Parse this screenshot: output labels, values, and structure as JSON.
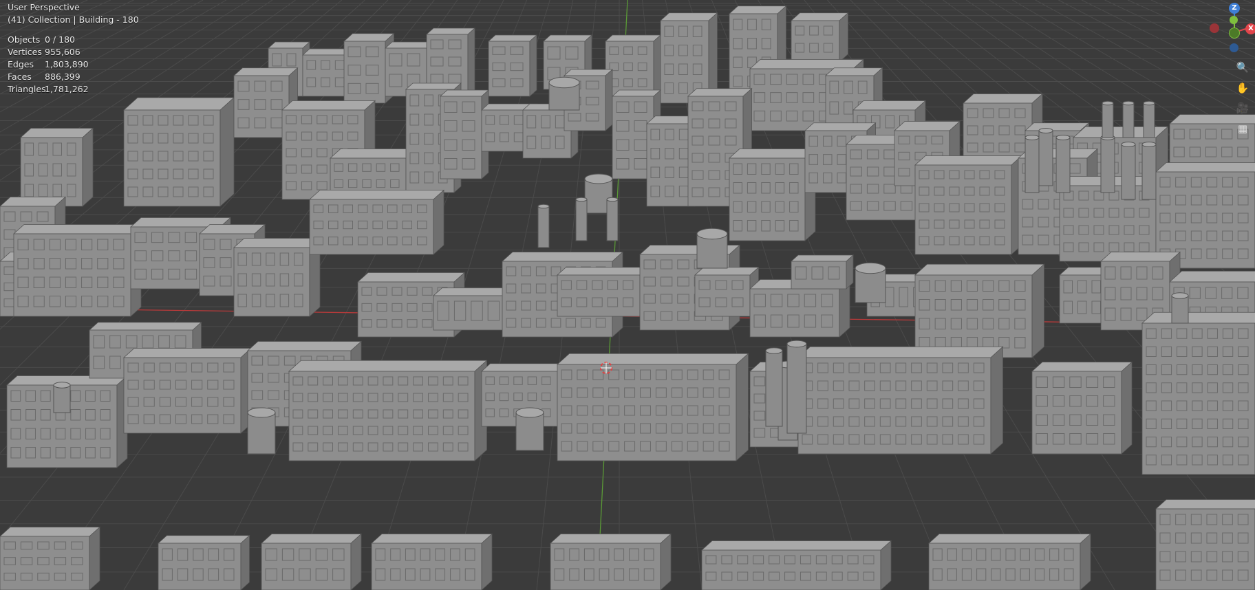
{
  "viewport": {
    "view_name": "User Perspective",
    "collection_info": "(41) Collection | Building - 180",
    "stats": [
      {
        "label": "Objects",
        "value": "0 / 180"
      },
      {
        "label": "Vertices",
        "value": "955,606"
      },
      {
        "label": "Edges",
        "value": "1,803,890"
      },
      {
        "label": "Faces",
        "value": "886,399"
      },
      {
        "label": "Triangles",
        "value": "1,781,262"
      }
    ]
  },
  "gizmo": {
    "z_label": "Z",
    "x_label": "X",
    "colors": {
      "x": "#e2454b",
      "y": "#7fbf3e",
      "z": "#3f7fd6",
      "neg_x": "#9a3438",
      "neg_y": "#4c7a28",
      "neg_z": "#2e5a93"
    }
  },
  "nav_icons": [
    "zoom-icon",
    "hand-pan-icon",
    "camera-icon",
    "orthographic-grid-icon"
  ],
  "scene": {
    "axis_colors": {
      "x_axis": "#b63a3a",
      "y_axis": "#5a9a36",
      "grid": "#4a4a4a",
      "background": "#3b3b3b"
    },
    "building_color": "#8f8f8f"
  }
}
